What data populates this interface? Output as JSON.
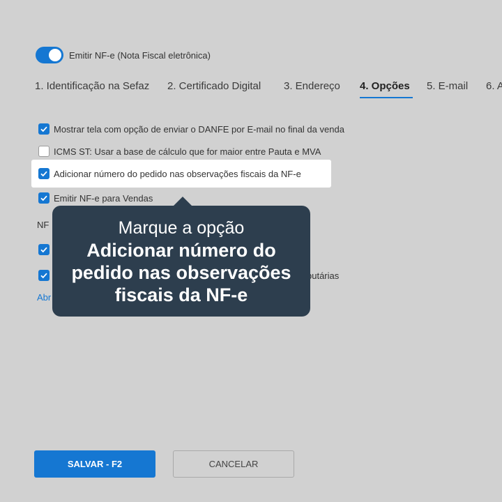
{
  "toggle": {
    "label": "Emitir NF-e (Nota Fiscal eletrônica)",
    "on": true
  },
  "tabs": [
    {
      "label": "1. Identificação na Sefaz"
    },
    {
      "label": "2. Certificado Digital"
    },
    {
      "label": "3. Endereço"
    },
    {
      "label": "4. Opções",
      "active": true
    },
    {
      "label": "5. E-mail"
    },
    {
      "label": "6. A"
    }
  ],
  "options": [
    {
      "label": "Mostrar tela com opção de enviar o DANFE por E-mail no final da venda",
      "checked": true
    },
    {
      "label": "ICMS ST: Usar a base de cálculo que for maior entre Pauta e MVA",
      "checked": false
    },
    {
      "label": "Adicionar número do pedido nas observações fiscais da NF-e",
      "checked": true
    },
    {
      "label": "Emitir NF-e para Vendas",
      "checked": true
    }
  ],
  "section_label": "NF",
  "lower_partial_text": "butárias",
  "link_partial": "Abr",
  "tooltip": {
    "line1": "Marque a opção",
    "bold": "Adicionar número do pedido nas observações fiscais da NF-e"
  },
  "buttons": {
    "save": "SALVAR - F2",
    "cancel": "CANCELAR"
  },
  "colors": {
    "accent": "#1577d2",
    "tooltip_bg": "#2d3e4e",
    "background": "#d1d1d1"
  }
}
